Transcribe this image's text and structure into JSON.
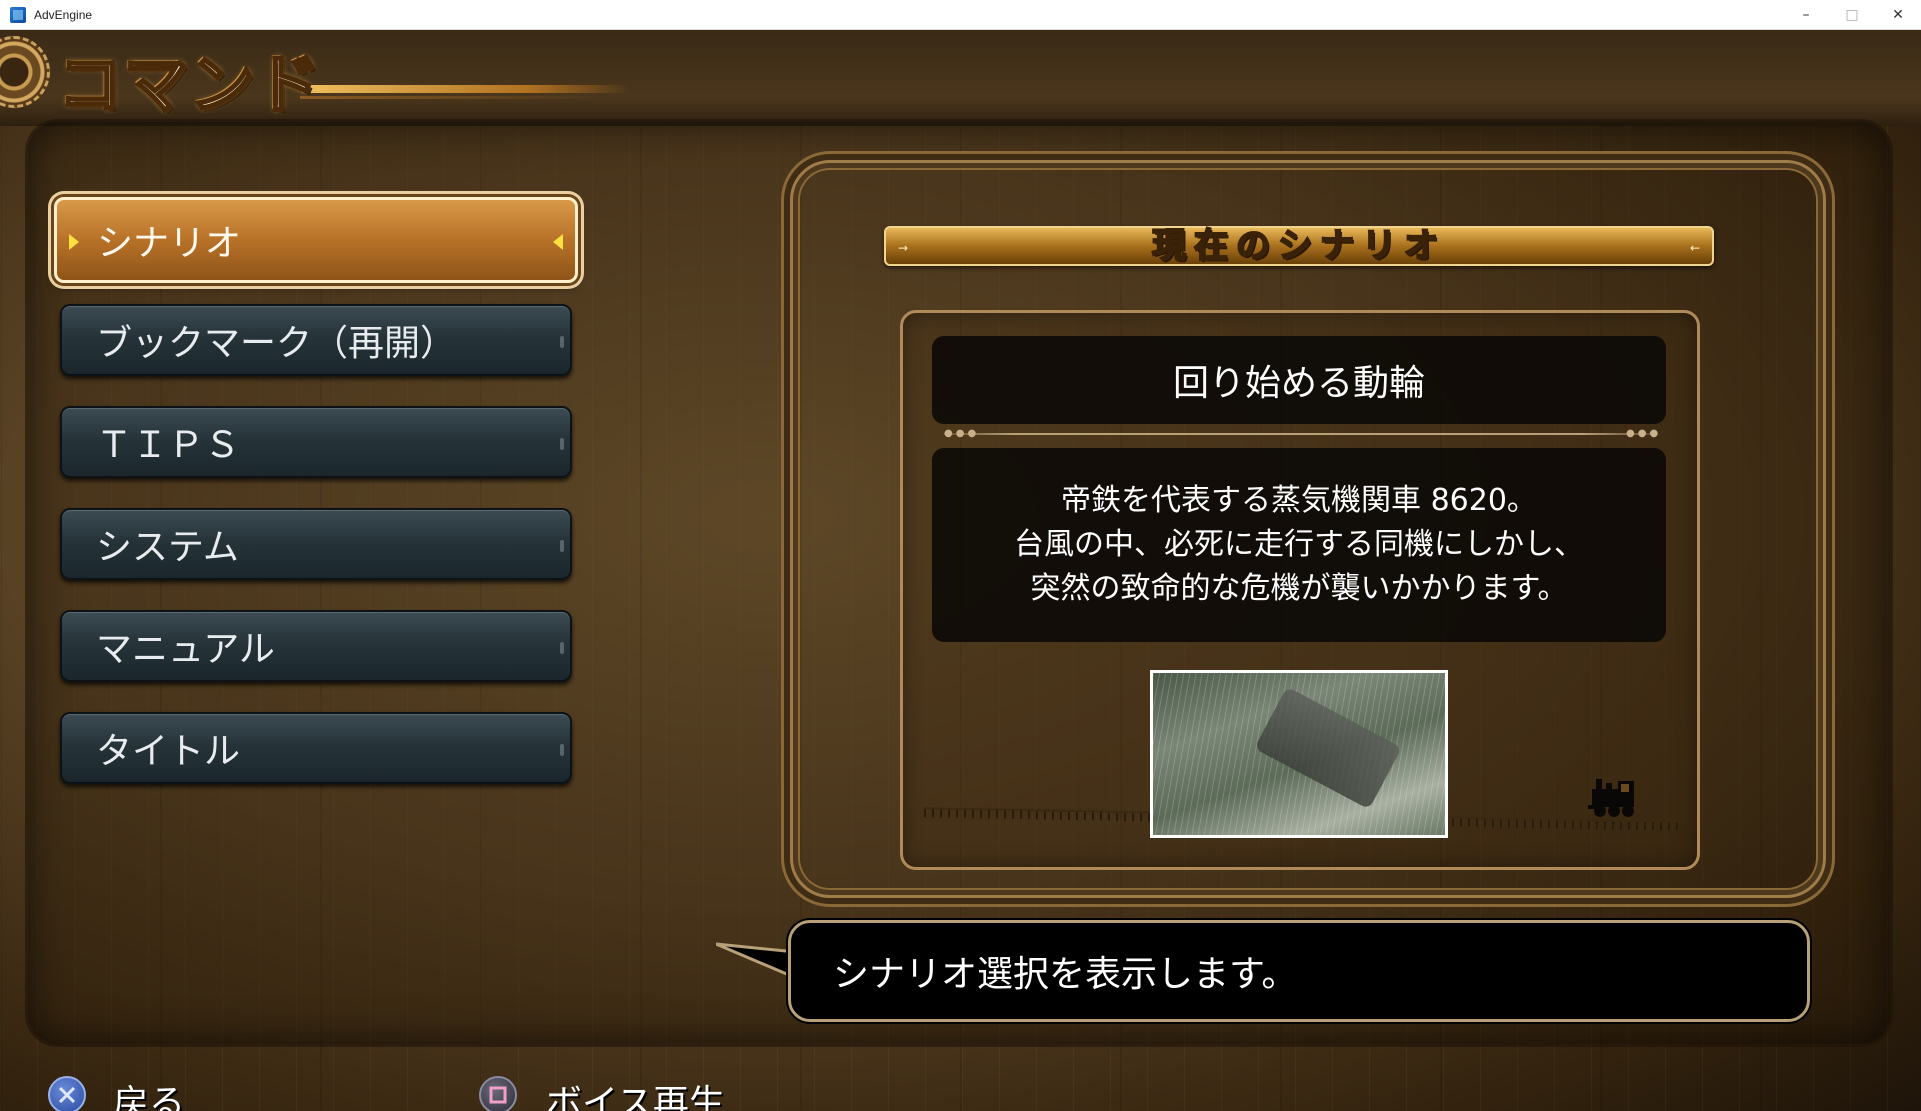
{
  "window": {
    "title": "AdvEngine",
    "minimize": "–",
    "maximize": "□",
    "close": "✕"
  },
  "header": {
    "title": "コマンド"
  },
  "menu": {
    "items": [
      {
        "label": "シナリオ",
        "selected": true
      },
      {
        "label": "ブックマーク（再開）",
        "selected": false
      },
      {
        "label": "ＴＩＰＳ",
        "selected": false
      },
      {
        "label": "システム",
        "selected": false
      },
      {
        "label": "マニュアル",
        "selected": false
      },
      {
        "label": "タイトル",
        "selected": false
      }
    ]
  },
  "scenario_panel": {
    "header": "現在のシナリオ",
    "chapter_title": "回り始める動輪",
    "description": [
      "帝鉄を代表する蒸気機関車 8620。",
      "台風の中、必死に走行する同機にしかし、",
      "突然の致命的な危機が襲いかかります。"
    ]
  },
  "help": {
    "text": "シナリオ選択を表示します。"
  },
  "controls": {
    "back_label": "戻る",
    "voice_label": "ボイス再生"
  },
  "colors": {
    "accent_gold": "#b87228",
    "button_dark": "#26343a",
    "frame_gold": "#a07c48"
  },
  "icons": {
    "back_button": "cross-icon",
    "voice_button": "square-icon",
    "panel_decoration": "steam-train-icon",
    "header_decoration": "gear-icon"
  }
}
